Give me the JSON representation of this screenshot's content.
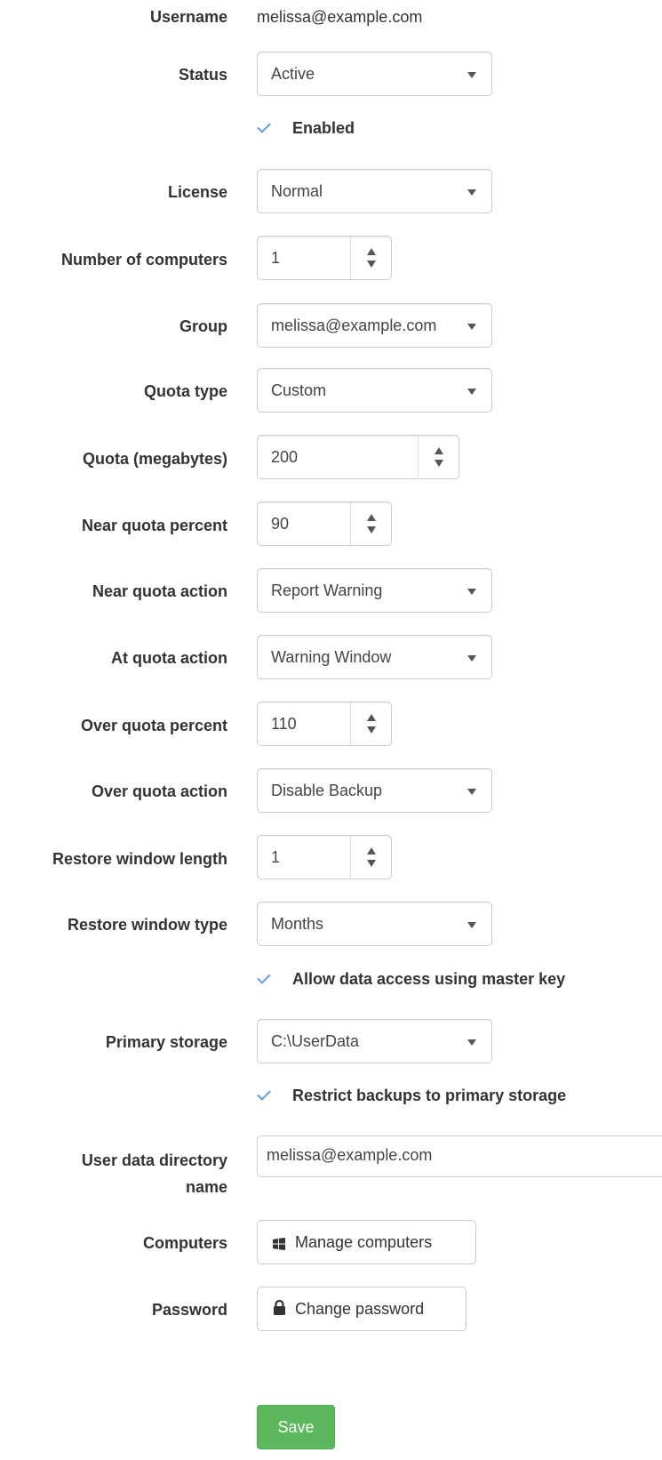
{
  "username": {
    "label": "Username",
    "value": "melissa@example.com"
  },
  "status": {
    "label": "Status",
    "value": "Active"
  },
  "enabled": {
    "label": "Enabled",
    "checked": true
  },
  "license": {
    "label": "License",
    "value": "Normal"
  },
  "num_computers": {
    "label": "Number of computers",
    "value": "1"
  },
  "group": {
    "label": "Group",
    "value": "melissa@example.com"
  },
  "quota_type": {
    "label": "Quota type",
    "value": "Custom"
  },
  "quota_mb": {
    "label": "Quota (megabytes)",
    "value": "200"
  },
  "near_quota_percent": {
    "label": "Near quota percent",
    "value": "90"
  },
  "near_quota_action": {
    "label": "Near quota action",
    "value": "Report Warning"
  },
  "at_quota_action": {
    "label": "At quota action",
    "value": "Warning Window"
  },
  "over_quota_percent": {
    "label": "Over quota percent",
    "value": "110"
  },
  "over_quota_action": {
    "label": "Over quota action",
    "value": "Disable Backup"
  },
  "restore_window_length": {
    "label": "Restore window length",
    "value": "1"
  },
  "restore_window_type": {
    "label": "Restore window type",
    "value": "Months"
  },
  "allow_master_key": {
    "label": "Allow data access using master key",
    "checked": true
  },
  "primary_storage": {
    "label": "Primary storage",
    "value": "C:\\UserData"
  },
  "restrict_backups": {
    "label": "Restrict backups to primary storage",
    "checked": true
  },
  "user_data_dir": {
    "label_line1": "User data directory",
    "label_line2": "name",
    "value": "melissa@example.com"
  },
  "computers": {
    "label": "Computers",
    "button_label": "Manage computers",
    "icon": "windows-icon"
  },
  "password": {
    "label": "Password",
    "button_label": "Change password",
    "icon": "lock-icon"
  },
  "save": {
    "label": "Save"
  },
  "colors": {
    "save_green": "#5cb85c",
    "check_blue": "#5d9cec"
  }
}
